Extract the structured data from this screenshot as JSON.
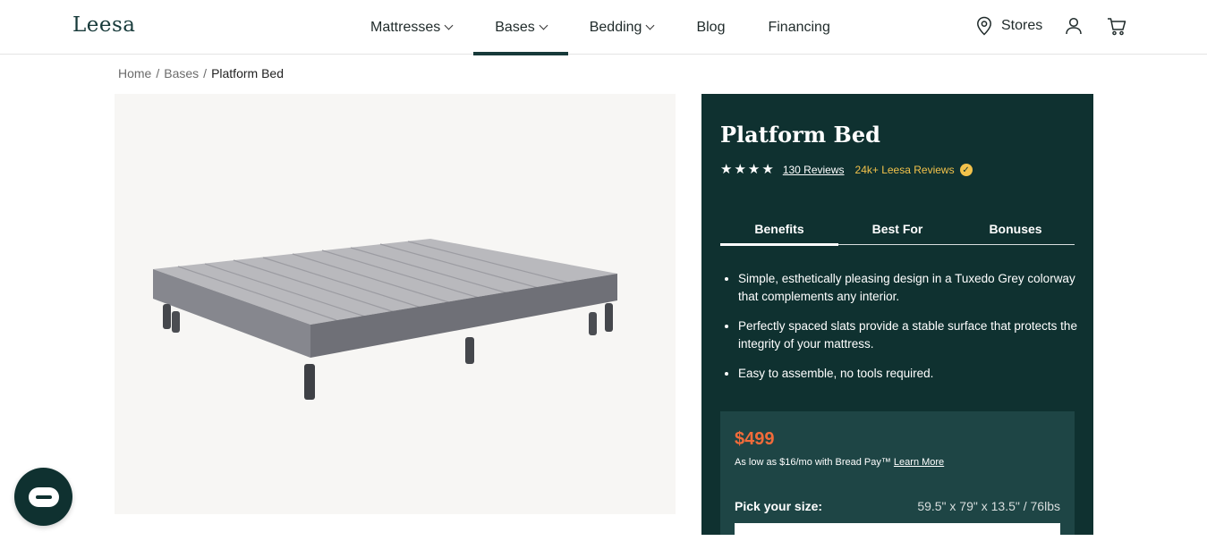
{
  "header": {
    "logo": "Leesa",
    "nav": [
      {
        "label": "Mattresses",
        "dropdown": true
      },
      {
        "label": "Bases",
        "dropdown": true,
        "active": true
      },
      {
        "label": "Bedding",
        "dropdown": true
      },
      {
        "label": "Blog",
        "dropdown": false
      },
      {
        "label": "Financing",
        "dropdown": false
      }
    ],
    "stores_label": "Stores",
    "icons": [
      "location-pin-icon",
      "user-icon",
      "cart-icon"
    ]
  },
  "breadcrumb": {
    "items": [
      "Home",
      "Bases"
    ],
    "current": "Platform Bed",
    "separator": "/"
  },
  "product": {
    "title": "Platform Bed",
    "rating_stars": 4,
    "reviews_label": "130 Reviews",
    "leesa_reviews_label": "24k+ Leesa Reviews",
    "tabs": [
      "Benefits",
      "Best For",
      "Bonuses"
    ],
    "active_tab": "Benefits",
    "benefits": [
      "Simple, esthetically pleasing design in a Tuxedo Grey colorway that complements any interior.",
      "Perfectly spaced slats provide a stable surface that protects the integrity of your mattress.",
      "Easy to assemble, no tools required."
    ],
    "price": "$499",
    "financing_text": "As low as $16/mo with Bread Pay™",
    "financing_link": "Learn More",
    "size_label": "Pick your size:",
    "dimensions": "59.5\" x 79\" x 13.5\" / 76lbs"
  },
  "colors": {
    "panel_bg": "#0f3130",
    "price": "#f26b3a",
    "accent_gold": "#f2c24b",
    "brand_dark": "#173a3a"
  }
}
